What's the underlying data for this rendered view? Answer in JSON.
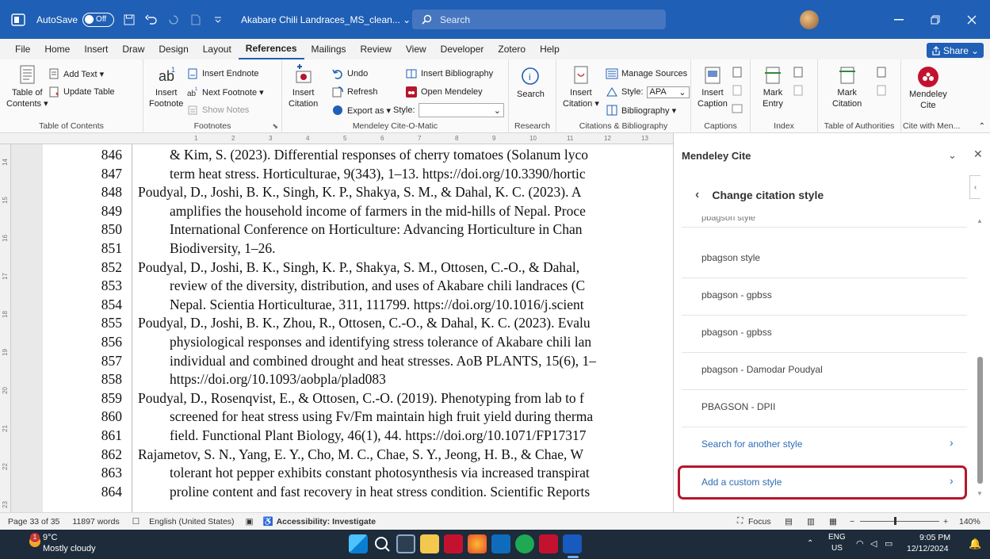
{
  "titlebar": {
    "autosave_label": "AutoSave",
    "autosave_state": "Off",
    "doc_title": "Akabare Chili Landraces_MS_clean...",
    "search_placeholder": "Search"
  },
  "menu": {
    "tabs": [
      "File",
      "Home",
      "Insert",
      "Draw",
      "Design",
      "Layout",
      "References",
      "Mailings",
      "Review",
      "View",
      "Developer",
      "Zotero",
      "Help"
    ],
    "active": "References",
    "share_label": "Share"
  },
  "ribbon": {
    "toc": {
      "line1": "Table of",
      "line2": "Contents ▾",
      "add_text": "Add Text ▾",
      "update_table": "Update Table",
      "group_label": "Table of Contents"
    },
    "footnotes": {
      "insert_line1": "Insert",
      "insert_line2": "Footnote",
      "insert_endnote": "Insert Endnote",
      "next_footnote": "Next Footnote ▾",
      "show_notes": "Show Notes",
      "group_label": "Footnotes"
    },
    "mendeley_cite_o_matic": {
      "insert_line1": "Insert",
      "insert_line2": "Citation",
      "undo": "Undo",
      "refresh": "Refresh",
      "export_as": "Export as ▾",
      "style_label": "Style:",
      "insert_bibliography": "Insert Bibliography",
      "open_mendeley": "Open Mendeley",
      "group_label": "Mendeley Cite-O-Matic"
    },
    "research": {
      "search": "Search",
      "group_label": "Research"
    },
    "citations": {
      "insert_line1": "Insert",
      "insert_line2": "Citation ▾",
      "manage_sources": "Manage Sources",
      "style_label": "Style:",
      "style_value": "APA",
      "bibliography": "Bibliography ▾",
      "group_label": "Citations & Bibliography"
    },
    "captions": {
      "insert_line1": "Insert",
      "insert_line2": "Caption",
      "group_label": "Captions"
    },
    "index": {
      "mark_line1": "Mark",
      "mark_line2": "Entry",
      "group_label": "Index"
    },
    "authorities": {
      "mark_line1": "Mark",
      "mark_line2": "Citation",
      "group_label": "Table of Authorities"
    },
    "mendeley": {
      "line1": "Mendeley",
      "line2": "Cite",
      "group_label": "Cite with Men..."
    }
  },
  "ruler": {
    "ticks": [
      "1",
      "2",
      "3",
      "4",
      "5",
      "6",
      "7",
      "8",
      "9",
      "10",
      "11",
      "12",
      "13"
    ]
  },
  "vruler": {
    "ticks": [
      "14",
      "15",
      "16",
      "17",
      "18",
      "19",
      "20",
      "21",
      "22",
      "23"
    ]
  },
  "document": {
    "lines": [
      {
        "num": "846",
        "text": "& Kim, S. (2023). Differential responses of cherry tomatoes (Solanum lyco",
        "indent": true
      },
      {
        "num": "847",
        "text": "term heat stress. Horticulturae, 9(343), 1–13. https://doi.org/10.3390/hortic",
        "indent": true
      },
      {
        "num": "848",
        "text": "Poudyal, D., Joshi, B. K., Singh, K. P., Shakya, S. M., & Dahal, K. C. (2023). A",
        "indent": false
      },
      {
        "num": "849",
        "text": "amplifies the household income of farmers in the mid-hills of Nepal. Proce",
        "indent": true
      },
      {
        "num": "850",
        "text": "International Conference on Horticulture: Advancing Horticulture in Chan",
        "indent": true
      },
      {
        "num": "851",
        "text": "Biodiversity, 1–26.",
        "indent": true
      },
      {
        "num": "852",
        "text": "Poudyal, D., Joshi, B. K., Singh, K. P., Shakya, S. M., Ottosen, C.-O., & Dahal,",
        "indent": false
      },
      {
        "num": "853",
        "text": "review of the diversity, distribution, and uses of Akabare chili landraces (C",
        "indent": true
      },
      {
        "num": "854",
        "text": "Nepal. Scientia Horticulturae, 311, 111799. https://doi.org/10.1016/j.scient",
        "indent": true
      },
      {
        "num": "855",
        "text": "Poudyal, D., Joshi, B. K., Zhou, R., Ottosen, C.-O., & Dahal, K. C. (2023). Evalu",
        "indent": false
      },
      {
        "num": "856",
        "text": "physiological responses and identifying stress tolerance of Akabare chili lan",
        "indent": true
      },
      {
        "num": "857",
        "text": "individual and combined drought and heat stresses. AoB PLANTS, 15(6), 1–",
        "indent": true
      },
      {
        "num": "858",
        "text": "https://doi.org/10.1093/aobpla/plad083",
        "indent": true
      },
      {
        "num": "859",
        "text": "Poudyal, D., Rosenqvist, E., & Ottosen, C.-O. (2019). Phenotyping from lab to f",
        "indent": false
      },
      {
        "num": "860",
        "text": "screened for heat stress using Fv/Fm maintain high fruit yield during therma",
        "indent": true
      },
      {
        "num": "861",
        "text": "field. Functional Plant Biology, 46(1), 44. https://doi.org/10.1071/FP17317",
        "indent": true
      },
      {
        "num": "862",
        "text": "Rajametov, S. N., Yang, E. Y., Cho, M. C., Chae, S. Y., Jeong, H. B., & Chae, W",
        "indent": false
      },
      {
        "num": "863",
        "text": "tolerant hot pepper exhibits constant photosynthesis via increased transpirat",
        "indent": true
      },
      {
        "num": "864",
        "text": "proline content and fast recovery in heat stress condition. Scientific Reports",
        "indent": true
      }
    ]
  },
  "panel": {
    "title": "Mendeley Cite",
    "header": "Change citation style",
    "partial_item": "pbagson style",
    "items": [
      "pbagson style",
      "pbagson - gpbss",
      "pbagson - gpbss",
      "pbagson - Damodar Poudyal",
      "PBAGSON - DPII"
    ],
    "search_another": "Search for another style",
    "add_custom": "Add a custom style",
    "highlight_color": "#b5172c"
  },
  "status": {
    "page": "Page 33 of 35",
    "words": "11897 words",
    "language": "English (United States)",
    "accessibility": "Accessibility: Investigate",
    "focus": "Focus",
    "zoom": "140%"
  },
  "taskbar": {
    "temp": "9°C",
    "weather": "Mostly cloudy",
    "badge": "1",
    "lang_line1": "ENG",
    "lang_line2": "US",
    "time": "9:05 PM",
    "date": "12/12/2024"
  }
}
